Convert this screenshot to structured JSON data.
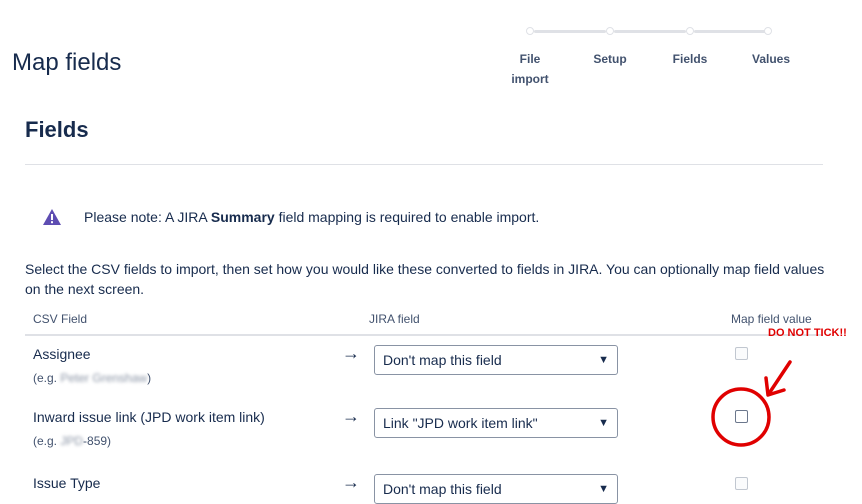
{
  "page": {
    "title": "Map fields"
  },
  "progress": {
    "steps": [
      "File import",
      "Setup",
      "Fields",
      "Values"
    ],
    "current_step": 3
  },
  "section": {
    "title": "Fields"
  },
  "notice": {
    "icon": "warning-icon",
    "prefix": "Please note: A JIRA ",
    "bold": "Summary",
    "suffix": " field mapping is required to enable import."
  },
  "intro": "Select the CSV fields to import, then set how you would like these converted to fields in JIRA. You can optionally map field values on the next screen.",
  "table": {
    "headers": {
      "csv_field": "CSV Field",
      "jira_field": "JIRA field",
      "map_value": "Map field value"
    },
    "rows": [
      {
        "name": "Assignee",
        "example_prefix": "(e.g. ",
        "example_value": "Peter Grenshaw",
        "example_suffix": ")",
        "jira_field": "Don't map this field",
        "map_value_checked": false,
        "map_value_enabled": false
      },
      {
        "name": "Inward issue link (JPD work item link)",
        "example_prefix": "(e.g. ",
        "example_value": "JPD",
        "example_suffix": "-859)",
        "jira_field": "Link \"JPD work item link\"",
        "map_value_checked": false,
        "map_value_enabled": true
      },
      {
        "name": "Issue Type",
        "jira_field": "Don't map this field",
        "map_value_checked": false,
        "map_value_enabled": false
      }
    ]
  },
  "annotation": {
    "text": "DO NOT TICK!!",
    "color": "#e00000"
  },
  "colors": {
    "text": "#172b4d",
    "subtle": "#42526e",
    "border": "#dfe1e6",
    "warning": "#5e4db2",
    "annotation": "#e00000"
  }
}
